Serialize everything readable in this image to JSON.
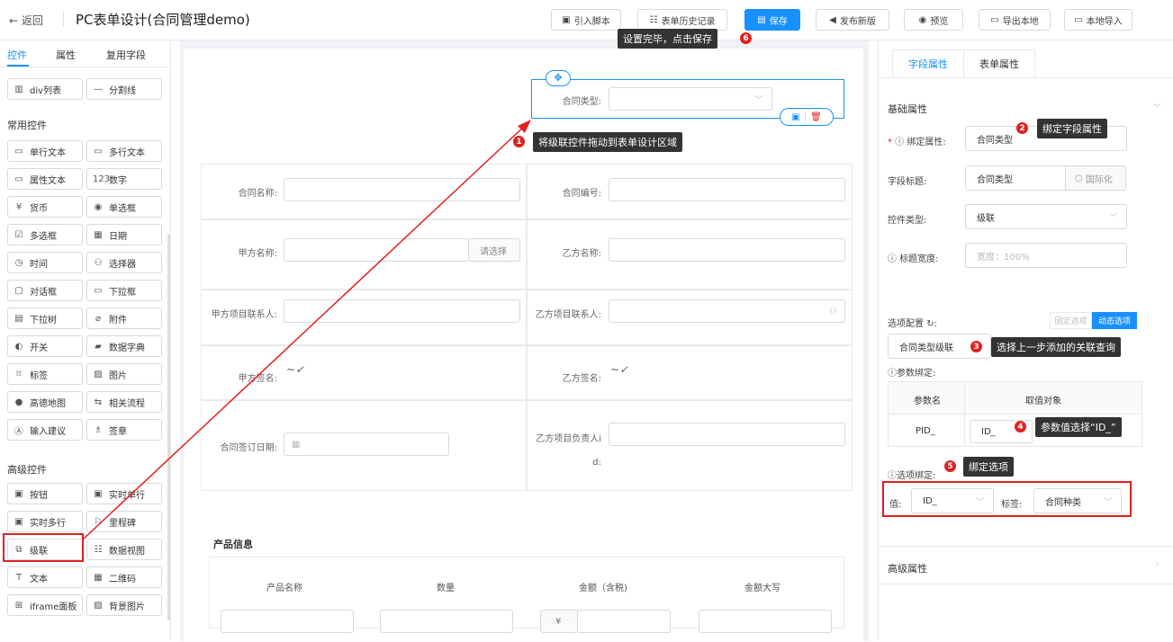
{
  "header": {
    "back_label": "← 返回",
    "title": "PC表单设计(合同管理demo)",
    "buttons": [
      {
        "label": "引入脚本",
        "icon": "script-icon"
      },
      {
        "label": "表单历史记录",
        "icon": "history-icon"
      },
      {
        "label": "保存",
        "icon": "save-icon"
      },
      {
        "label": "发布新版",
        "icon": "publish-icon"
      },
      {
        "label": "预览",
        "icon": "preview-icon"
      },
      {
        "label": "导出本地",
        "icon": "export-icon"
      },
      {
        "label": "本地导入",
        "icon": "import-icon"
      }
    ]
  },
  "left": {
    "tabs": [
      "控件",
      "属性",
      "复用字段"
    ],
    "top_items": [
      {
        "label": "div列表",
        "icon": "▥"
      },
      {
        "label": "分割线",
        "icon": "—"
      }
    ],
    "common_title": "常用控件",
    "common": [
      {
        "label": "单行文本",
        "icon": "▭"
      },
      {
        "label": "多行文本",
        "icon": "▭"
      },
      {
        "label": "属性文本",
        "icon": "▭"
      },
      {
        "label": "数字",
        "icon": "123"
      },
      {
        "label": "货币",
        "icon": "¥"
      },
      {
        "label": "单选框",
        "icon": "◉"
      },
      {
        "label": "多选框",
        "icon": "☑"
      },
      {
        "label": "日期",
        "icon": "▦"
      },
      {
        "label": "时间",
        "icon": "◷"
      },
      {
        "label": "选择器",
        "icon": "⚇"
      },
      {
        "label": "对话框",
        "icon": "▢"
      },
      {
        "label": "下拉框",
        "icon": "▭"
      },
      {
        "label": "下拉树",
        "icon": "▤"
      },
      {
        "label": "附件",
        "icon": "⌀"
      },
      {
        "label": "开关",
        "icon": "◐"
      },
      {
        "label": "数据字典",
        "icon": "▰"
      },
      {
        "label": "标签",
        "icon": "⌑"
      },
      {
        "label": "图片",
        "icon": "▨"
      },
      {
        "label": "高德地图",
        "icon": "●"
      },
      {
        "label": "相关流程",
        "icon": "⇆"
      },
      {
        "label": "输入建议",
        "icon": "Ⓐ"
      },
      {
        "label": "签章",
        "icon": "♗"
      }
    ],
    "advanced_title": "高级控件",
    "advanced": [
      {
        "label": "按钮",
        "icon": "▣"
      },
      {
        "label": "实时单行",
        "icon": "▣"
      },
      {
        "label": "实时多行",
        "icon": "▣"
      },
      {
        "label": "里程碑",
        "icon": "⚐"
      },
      {
        "label": "级联",
        "icon": "⧉"
      },
      {
        "label": "数据视图",
        "icon": "☷"
      },
      {
        "label": "文本",
        "icon": "T"
      },
      {
        "label": "二维码",
        "icon": "▦"
      },
      {
        "label": "iframe面板",
        "icon": "⊞"
      },
      {
        "label": "背景图片",
        "icon": "▨"
      }
    ]
  },
  "canvas": {
    "selected_field": {
      "label": "合同类型:"
    },
    "fields": [
      {
        "label": "合同名称:"
      },
      {
        "label": "合同编号:"
      },
      {
        "label": "甲方名称:",
        "button": "请选择"
      },
      {
        "label": "乙方名称:"
      },
      {
        "label": "甲方项目联系人:"
      },
      {
        "label": "乙方项目联系人:"
      },
      {
        "label": "甲方签名:"
      },
      {
        "label": "乙方签名:"
      },
      {
        "label": "合同签订日期:"
      },
      {
        "label": "乙方项目负责人id:"
      }
    ],
    "product_title": "产品信息",
    "product_columns": [
      "产品名称",
      "数量",
      "金额（含税)",
      "金额大写"
    ],
    "currency_prefix": "¥"
  },
  "right": {
    "tabs": [
      "字段属性",
      "表单属性"
    ],
    "basic_title": "基础属性",
    "bind_label": "绑定属性:",
    "bind_value": "合同类型",
    "field_title_label": "字段标题:",
    "field_title_value": "合同类型",
    "i18n_label": "国际化",
    "control_type_label": "控件类型:",
    "control_type_value": "级联",
    "title_width_label": "标题宽度:",
    "title_width_placeholder": "宽度：100%",
    "options_label": "选项配置",
    "options_static": "固定选项",
    "options_dynamic": "动态选项",
    "query_value": "合同类型级联",
    "param_bind_label": "参数绑定:",
    "param_cols": [
      "参数名",
      "取值对象"
    ],
    "param_name": "PID_",
    "param_value": "ID_",
    "option_bind_label": "选项绑定:",
    "value_label": "值:",
    "value_value": "ID_",
    "tag_label": "标签:",
    "tag_value": "合同种类",
    "advanced_title": "高级属性"
  },
  "tips": [
    {
      "num": "1",
      "text": "将级联控件拖动到表单设计区域"
    },
    {
      "num": "2",
      "text": "绑定字段属性"
    },
    {
      "num": "3",
      "text": "选择上一步添加的关联查询"
    },
    {
      "num": "4",
      "text": "参数值选择“ID_”"
    },
    {
      "num": "5",
      "text": "绑定选项"
    },
    {
      "num": "6",
      "text": "设置完毕，点击保存"
    }
  ],
  "colors": {
    "accent": "#1890ff",
    "annotation": "#e02020"
  }
}
